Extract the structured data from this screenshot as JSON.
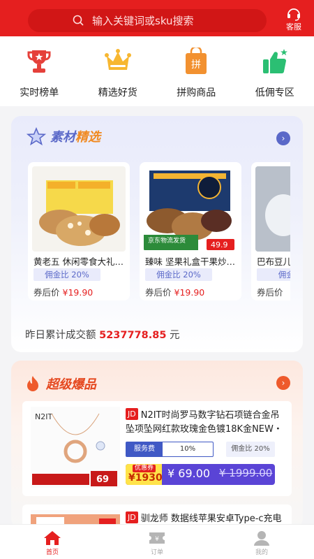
{
  "header": {
    "search_placeholder": "输入关键词或sku搜索",
    "service_label": "客服",
    "icons": {
      "search": "search-icon",
      "service": "headset-icon"
    }
  },
  "categories": [
    {
      "label": "实时榜单",
      "icon": "trophy-icon"
    },
    {
      "label": "精选好货",
      "icon": "crown-icon"
    },
    {
      "label": "拼购商品",
      "icon": "bag-icon",
      "badge": "拼"
    },
    {
      "label": "低佣专区",
      "icon": "thumbs-up-icon"
    }
  ],
  "materials": {
    "title_part1": "素材",
    "title_part2": "精选",
    "products": [
      {
        "name": "黄老五 休闲零食大礼…",
        "commission": "佣金比 20%",
        "price_label": "券后价",
        "price": "¥19.90"
      },
      {
        "name": "臻味 坚果礼盒干果炒…",
        "commission": "佣金比 20%",
        "price_label": "券后价",
        "price": "¥19.90",
        "tag_price": "49.9",
        "banner": "京东物流发货"
      },
      {
        "name": "巴布豆儿…",
        "commission": "佣金比",
        "price_label": "券后价",
        "price": ""
      }
    ],
    "turnover_label": "昨日累计成交额",
    "turnover_value": "5237778.85",
    "turnover_unit": "元"
  },
  "hot": {
    "title": "超级爆品",
    "items": [
      {
        "platform": "JD",
        "title": "N2IT时尚罗马数字钻石项链合金吊坠项坠网红款玫瑰金色镀18K金NEW・",
        "fee_label": "服务费",
        "fee_value": "10%",
        "commission": "佣金比 20%",
        "coupon_tag": "优惠券",
        "coupon_value": "¥1930",
        "price": "¥ 69.00",
        "old_price": "¥ 1999.00",
        "brand": "N2IT",
        "img_price": "69"
      },
      {
        "platform": "JD",
        "title": "驯龙师 数据线苹果安卓Type-c充电"
      }
    ]
  },
  "tabbar": [
    {
      "label": "首页",
      "icon": "home-icon",
      "active": true
    },
    {
      "label": "订单",
      "icon": "ticket-icon",
      "active": false
    },
    {
      "label": "我的",
      "icon": "user-icon",
      "active": false
    }
  ],
  "colors": {
    "brand_red": "#e51f1f",
    "accent_blue": "#5a68c8",
    "accent_orange": "#f08a22"
  }
}
